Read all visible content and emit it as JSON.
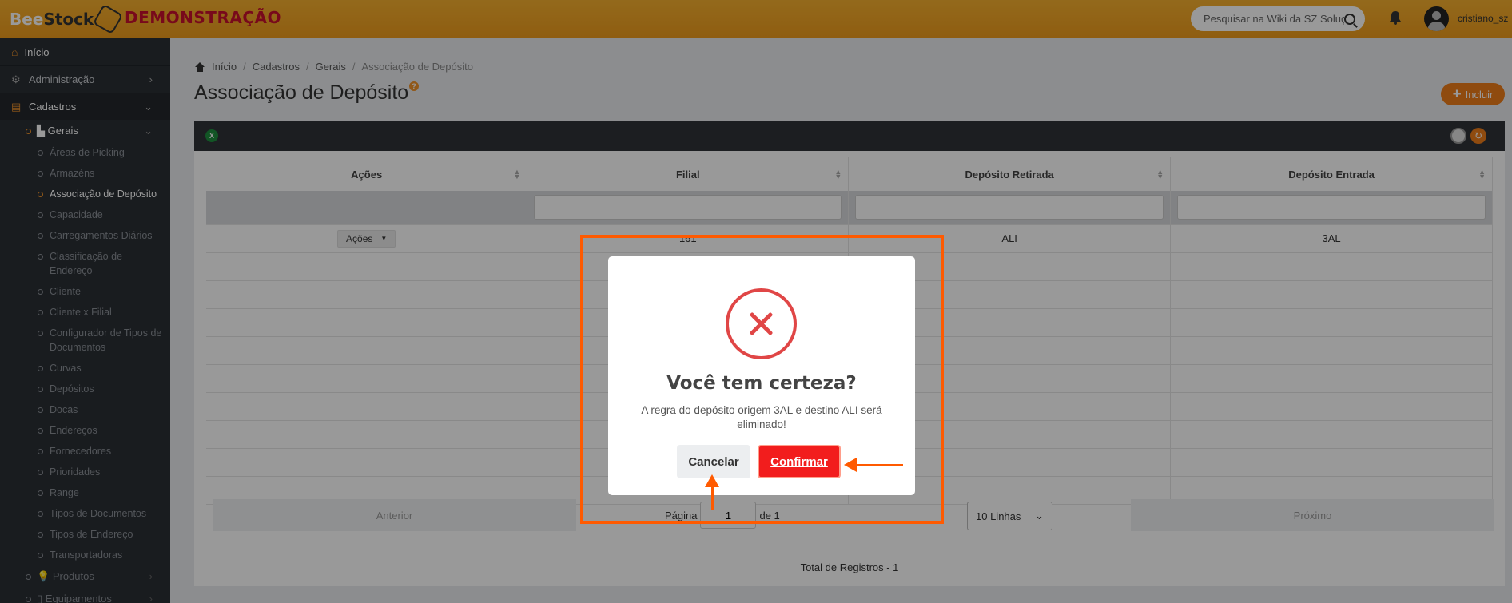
{
  "header": {
    "logo_part1": "Bee",
    "logo_part2": "Stock",
    "environment": "DEMONSTRAÇÃO",
    "search_placeholder": "Pesquisar na Wiki da SZ Soluções",
    "username": "cristiano_sz",
    "accent_color": "#ee9b1c"
  },
  "sidebar": {
    "top_items": [
      {
        "label": "Início",
        "icon": "home-icon"
      },
      {
        "label": "Administração",
        "icon": "gears-icon"
      },
      {
        "label": "Cadastros",
        "icon": "list-icon"
      }
    ],
    "group": {
      "label": "Gerais",
      "icon": "industry-icon"
    },
    "sub_items": [
      "Áreas de Picking",
      "Armazéns",
      "Associação de Depósito",
      "Capacidade",
      "Carregamentos Diários",
      "Classificação de Endereço",
      "Cliente",
      "Cliente x Filial",
      "Configurador de Tipos de Documentos",
      "Curvas",
      "Depósitos",
      "Docas",
      "Endereços",
      "Fornecedores",
      "Prioridades",
      "Range",
      "Tipos de Documentos",
      "Tipos de Endereço",
      "Transportadoras"
    ],
    "bottom_items": [
      {
        "label": "Produtos",
        "icon": "lightbulb-icon"
      },
      {
        "label": "Equipamentos",
        "icon": "mobile-icon"
      }
    ]
  },
  "breadcrumb": [
    "Início",
    "Cadastros",
    "Gerais",
    "Associação de Depósito"
  ],
  "page": {
    "title": "Associação de Depósito",
    "help": "?",
    "add_button": "Incluir"
  },
  "table": {
    "columns": [
      "Ações",
      "Filial",
      "Depósito Retirada",
      "Depósito Entrada"
    ],
    "rows": [
      {
        "acoes": "Ações",
        "filial": "161",
        "retirada": "ALI",
        "entrada": "3AL"
      }
    ]
  },
  "pager": {
    "prev": "Anterior",
    "page_label": "Página",
    "page_value": "1",
    "of_label": "de 1",
    "rows_select": "10 Linhas",
    "next": "Próximo",
    "total": "Total de Registros - 1"
  },
  "modal": {
    "title": "Você tem certeza?",
    "text": "A regra do depósito origem 3AL e destino ALI será eliminado!",
    "cancel": "Cancelar",
    "confirm": "Confirmar",
    "error_color": "#e04646",
    "confirm_color": "#f21d1d",
    "highlight_color": "#ff5a00"
  }
}
